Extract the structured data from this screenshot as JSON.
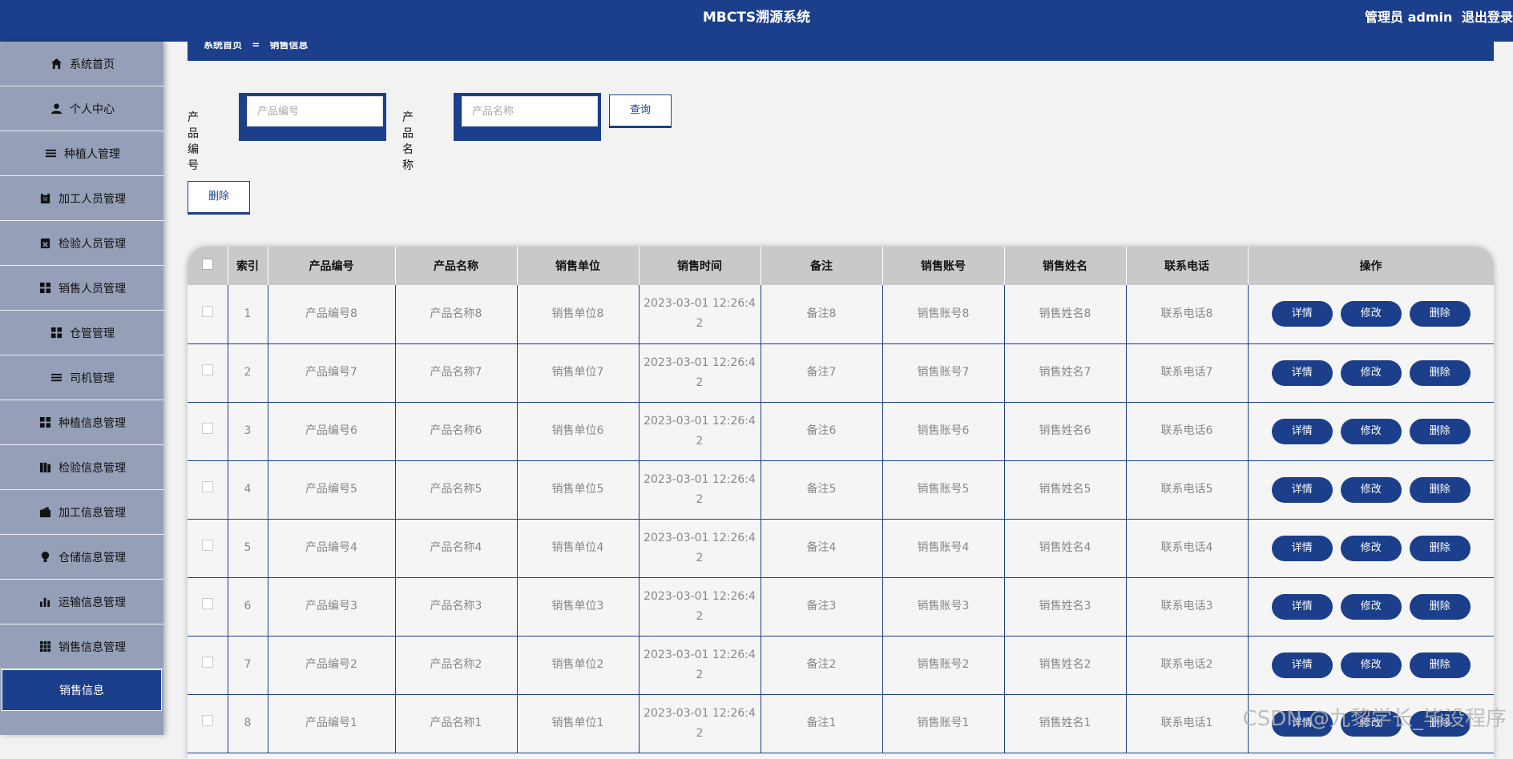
{
  "header": {
    "title": "MBCTS溯源系统",
    "user_label": "管理员 admin",
    "logout": "退出登录"
  },
  "sidebar": {
    "items": [
      {
        "label": "系统首页",
        "icon": "home-icon"
      },
      {
        "label": "个人中心",
        "icon": "user-icon"
      },
      {
        "label": "种植人管理",
        "icon": "list-icon"
      },
      {
        "label": "加工人员管理",
        "icon": "clipboard-icon"
      },
      {
        "label": "检验人员管理",
        "icon": "clipboard-x-icon"
      },
      {
        "label": "销售人员管理",
        "icon": "grid-icon"
      },
      {
        "label": "仓管管理",
        "icon": "grid-icon"
      },
      {
        "label": "司机管理",
        "icon": "list-icon"
      },
      {
        "label": "种植信息管理",
        "icon": "grid-icon"
      },
      {
        "label": "检验信息管理",
        "icon": "book-icon"
      },
      {
        "label": "加工信息管理",
        "icon": "wallet-icon"
      },
      {
        "label": "仓储信息管理",
        "icon": "bulb-icon"
      },
      {
        "label": "运输信息管理",
        "icon": "bar-chart-icon"
      },
      {
        "label": "销售信息管理",
        "icon": "apps-icon"
      }
    ],
    "active_item": "销售信息"
  },
  "breadcrumb": {
    "home": "系统首页",
    "sep": "=",
    "current": "销售信息"
  },
  "search": {
    "label1": "产品编号",
    "placeholder1": "产品编号",
    "label2": "产品名称",
    "placeholder2": "产品名称",
    "query_button": "查询"
  },
  "toolbar": {
    "delete_button": "删除"
  },
  "table": {
    "headers": [
      "",
      "索引",
      "产品编号",
      "产品名称",
      "销售单位",
      "销售时间",
      "备注",
      "销售账号",
      "销售姓名",
      "联系电话",
      "操作"
    ],
    "rows": [
      {
        "index": "1",
        "code": "产品编号8",
        "name": "产品名称8",
        "unit": "销售单位8",
        "time1": "2023-03-01 12:26:4",
        "time2": "2",
        "note": "备注8",
        "account": "销售账号8",
        "seller": "销售姓名8",
        "phone": "联系电话8"
      },
      {
        "index": "2",
        "code": "产品编号7",
        "name": "产品名称7",
        "unit": "销售单位7",
        "time1": "2023-03-01 12:26:4",
        "time2": "2",
        "note": "备注7",
        "account": "销售账号7",
        "seller": "销售姓名7",
        "phone": "联系电话7"
      },
      {
        "index": "3",
        "code": "产品编号6",
        "name": "产品名称6",
        "unit": "销售单位6",
        "time1": "2023-03-01 12:26:4",
        "time2": "2",
        "note": "备注6",
        "account": "销售账号6",
        "seller": "销售姓名6",
        "phone": "联系电话6"
      },
      {
        "index": "4",
        "code": "产品编号5",
        "name": "产品名称5",
        "unit": "销售单位5",
        "time1": "2023-03-01 12:26:4",
        "time2": "2",
        "note": "备注5",
        "account": "销售账号5",
        "seller": "销售姓名5",
        "phone": "联系电话5"
      },
      {
        "index": "5",
        "code": "产品编号4",
        "name": "产品名称4",
        "unit": "销售单位4",
        "time1": "2023-03-01 12:26:4",
        "time2": "2",
        "note": "备注4",
        "account": "销售账号4",
        "seller": "销售姓名4",
        "phone": "联系电话4"
      },
      {
        "index": "6",
        "code": "产品编号3",
        "name": "产品名称3",
        "unit": "销售单位3",
        "time1": "2023-03-01 12:26:4",
        "time2": "2",
        "note": "备注3",
        "account": "销售账号3",
        "seller": "销售姓名3",
        "phone": "联系电话3"
      },
      {
        "index": "7",
        "code": "产品编号2",
        "name": "产品名称2",
        "unit": "销售单位2",
        "time1": "2023-03-01 12:26:4",
        "time2": "2",
        "note": "备注2",
        "account": "销售账号2",
        "seller": "销售姓名2",
        "phone": "联系电话2"
      },
      {
        "index": "8",
        "code": "产品编号1",
        "name": "产品名称1",
        "unit": "销售单位1",
        "time1": "2023-03-01 12:26:4",
        "time2": "2",
        "note": "备注1",
        "account": "销售账号1",
        "seller": "销售姓名1",
        "phone": "联系电话1"
      }
    ],
    "actions": {
      "detail": "详情",
      "edit": "修改",
      "delete": "删除"
    }
  },
  "watermark": "CSDN @九黎学长_毕设程序",
  "colors": {
    "primary": "#1b3f8b",
    "sidebar": "#95a0b8",
    "background": "#f2f2f2"
  }
}
